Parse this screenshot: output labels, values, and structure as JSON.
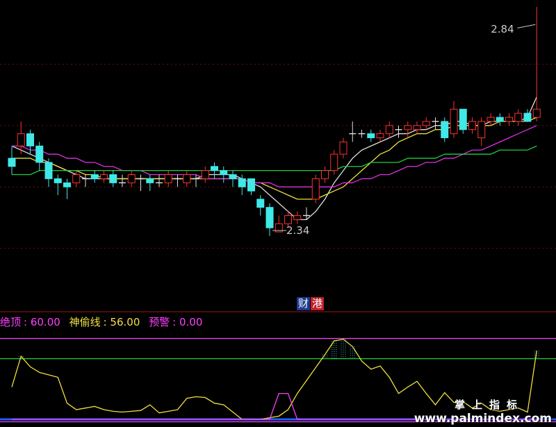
{
  "chart_data": [
    {
      "type": "candlestick",
      "ylim": [
        2.15,
        2.9
      ],
      "annotations": [
        {
          "text": "2.84",
          "value": 2.84
        },
        {
          "text": "2.34",
          "value": 2.34
        }
      ],
      "badges": [
        {
          "text": "财",
          "color": "#1a3a8c"
        },
        {
          "text": "港",
          "color": "#c0202a"
        }
      ],
      "candles": [
        [
          2.52,
          2.5,
          2.55,
          2.48
        ],
        [
          2.55,
          2.58,
          2.61,
          2.53
        ],
        [
          2.58,
          2.55,
          2.59,
          2.53
        ],
        [
          2.55,
          2.51,
          2.56,
          2.49
        ],
        [
          2.51,
          2.47,
          2.52,
          2.45
        ],
        [
          2.47,
          2.46,
          2.48,
          2.43
        ],
        [
          2.46,
          2.45,
          2.47,
          2.42
        ],
        [
          2.46,
          2.48,
          2.49,
          2.45
        ],
        [
          2.47,
          2.47,
          2.48,
          2.45
        ],
        [
          2.48,
          2.47,
          2.49,
          2.46
        ],
        [
          2.47,
          2.48,
          2.49,
          2.46
        ],
        [
          2.48,
          2.46,
          2.49,
          2.45
        ],
        [
          2.46,
          2.46,
          2.48,
          2.45
        ],
        [
          2.46,
          2.48,
          2.49,
          2.45
        ],
        [
          2.47,
          2.47,
          2.48,
          2.44
        ],
        [
          2.47,
          2.46,
          2.48,
          2.44
        ],
        [
          2.46,
          2.46,
          2.48,
          2.45
        ],
        [
          2.46,
          2.48,
          2.49,
          2.45
        ],
        [
          2.47,
          2.47,
          2.48,
          2.45
        ],
        [
          2.46,
          2.48,
          2.49,
          2.45
        ],
        [
          2.47,
          2.47,
          2.48,
          2.45
        ],
        [
          2.47,
          2.49,
          2.5,
          2.46
        ],
        [
          2.5,
          2.49,
          2.51,
          2.47
        ],
        [
          2.49,
          2.48,
          2.5,
          2.46
        ],
        [
          2.48,
          2.47,
          2.49,
          2.45
        ],
        [
          2.47,
          2.45,
          2.48,
          2.43
        ],
        [
          2.47,
          2.44,
          2.47,
          2.43
        ],
        [
          2.42,
          2.4,
          2.43,
          2.38
        ],
        [
          2.4,
          2.35,
          2.41,
          2.33
        ],
        [
          2.34,
          2.36,
          2.38,
          2.34
        ],
        [
          2.36,
          2.38,
          2.39,
          2.35
        ],
        [
          2.37,
          2.38,
          2.39,
          2.36
        ],
        [
          2.38,
          2.38,
          2.4,
          2.37
        ],
        [
          2.42,
          2.47,
          2.48,
          2.41
        ],
        [
          2.47,
          2.49,
          2.5,
          2.46
        ],
        [
          2.49,
          2.53,
          2.54,
          2.48
        ],
        [
          2.53,
          2.56,
          2.57,
          2.52
        ],
        [
          2.58,
          2.58,
          2.61,
          2.56
        ],
        [
          2.58,
          2.58,
          2.59,
          2.57
        ],
        [
          2.58,
          2.57,
          2.59,
          2.56
        ],
        [
          2.57,
          2.58,
          2.59,
          2.56
        ],
        [
          2.58,
          2.6,
          2.61,
          2.57
        ],
        [
          2.59,
          2.59,
          2.6,
          2.57
        ],
        [
          2.59,
          2.6,
          2.61,
          2.57
        ],
        [
          2.59,
          2.6,
          2.61,
          2.58
        ],
        [
          2.6,
          2.61,
          2.62,
          2.59
        ],
        [
          2.61,
          2.61,
          2.62,
          2.59
        ],
        [
          2.61,
          2.57,
          2.62,
          2.56
        ],
        [
          2.58,
          2.64,
          2.66,
          2.57
        ],
        [
          2.64,
          2.59,
          2.64,
          2.58
        ],
        [
          2.59,
          2.61,
          2.62,
          2.58
        ],
        [
          2.57,
          2.61,
          2.62,
          2.55
        ],
        [
          2.61,
          2.62,
          2.63,
          2.6
        ],
        [
          2.62,
          2.61,
          2.63,
          2.6
        ],
        [
          2.61,
          2.62,
          2.63,
          2.6
        ],
        [
          2.61,
          2.63,
          2.64,
          2.6
        ],
        [
          2.63,
          2.61,
          2.64,
          2.61
        ],
        [
          2.62,
          2.64,
          2.89,
          2.61
        ]
      ],
      "series": [
        {
          "color": "#e0e0e0",
          "values": [
            2.55,
            2.54,
            2.53,
            2.52,
            2.51,
            2.5,
            2.49,
            2.48,
            2.47,
            2.47,
            2.47,
            2.47,
            2.47,
            2.47,
            2.47,
            2.47,
            2.47,
            2.47,
            2.47,
            2.47,
            2.47,
            2.48,
            2.48,
            2.48,
            2.48,
            2.47,
            2.46,
            2.45,
            2.43,
            2.41,
            2.39,
            2.37,
            2.37,
            2.39,
            2.42,
            2.46,
            2.49,
            2.52,
            2.54,
            2.55,
            2.56,
            2.57,
            2.58,
            2.58,
            2.59,
            2.59,
            2.6,
            2.6,
            2.61,
            2.61,
            2.6,
            2.6,
            2.61,
            2.61,
            2.61,
            2.61,
            2.62,
            2.67
          ]
        },
        {
          "color": "#f0e040",
          "values": [
            2.52,
            2.52,
            2.52,
            2.51,
            2.51,
            2.5,
            2.49,
            2.49,
            2.48,
            2.48,
            2.47,
            2.47,
            2.47,
            2.47,
            2.47,
            2.47,
            2.47,
            2.47,
            2.47,
            2.47,
            2.47,
            2.47,
            2.47,
            2.47,
            2.47,
            2.47,
            2.46,
            2.46,
            2.45,
            2.44,
            2.43,
            2.42,
            2.42,
            2.42,
            2.43,
            2.44,
            2.45,
            2.47,
            2.49,
            2.51,
            2.53,
            2.54,
            2.56,
            2.57,
            2.58,
            2.58,
            2.59,
            2.59,
            2.6,
            2.6,
            2.6,
            2.6,
            2.6,
            2.61,
            2.61,
            2.61,
            2.61,
            2.62
          ]
        },
        {
          "color": "#e030e0",
          "values": [
            2.55,
            2.55,
            2.54,
            2.54,
            2.53,
            2.53,
            2.52,
            2.52,
            2.51,
            2.51,
            2.5,
            2.5,
            2.49,
            2.49,
            2.49,
            2.48,
            2.48,
            2.48,
            2.48,
            2.48,
            2.48,
            2.47,
            2.47,
            2.47,
            2.47,
            2.47,
            2.46,
            2.46,
            2.46,
            2.45,
            2.45,
            2.45,
            2.45,
            2.45,
            2.45,
            2.45,
            2.46,
            2.46,
            2.47,
            2.47,
            2.48,
            2.48,
            2.49,
            2.5,
            2.5,
            2.51,
            2.51,
            2.52,
            2.52,
            2.53,
            2.54,
            2.54,
            2.55,
            2.56,
            2.57,
            2.58,
            2.59,
            2.6
          ]
        },
        {
          "color": "#20d040",
          "values": [
            2.48,
            2.48,
            2.48,
            2.49,
            2.49,
            2.49,
            2.49,
            2.49,
            2.49,
            2.49,
            2.49,
            2.49,
            2.49,
            2.49,
            2.49,
            2.49,
            2.49,
            2.49,
            2.49,
            2.49,
            2.49,
            2.49,
            2.49,
            2.49,
            2.49,
            2.49,
            2.49,
            2.49,
            2.49,
            2.49,
            2.49,
            2.49,
            2.49,
            2.49,
            2.49,
            2.49,
            2.5,
            2.5,
            2.5,
            2.51,
            2.51,
            2.51,
            2.51,
            2.52,
            2.52,
            2.52,
            2.52,
            2.53,
            2.53,
            2.53,
            2.53,
            2.53,
            2.53,
            2.54,
            2.54,
            2.54,
            2.54,
            2.55
          ]
        }
      ]
    },
    {
      "type": "line",
      "ylim": [
        0,
        115
      ],
      "legend": [
        {
          "label": "绝顶",
          "value": "60.00",
          "color": "#ff40ff"
        },
        {
          "label": "神偷线",
          "value": "56.00",
          "color": "#f0e040"
        },
        {
          "label": "预警",
          "value": "0.00",
          "color": "#ff40ff"
        }
      ],
      "levels": [
        {
          "value": 100,
          "color": "#ff40ff"
        },
        {
          "value": 75,
          "color": "#20d040"
        },
        {
          "value": 0,
          "color": "#2060ff"
        },
        {
          "value": -3,
          "color": "#ff40ff"
        }
      ],
      "series": [
        {
          "name": "神偷线",
          "color": "#f0e040",
          "values": [
            40,
            78,
            65,
            58,
            55,
            52,
            20,
            12,
            14,
            16,
            12,
            10,
            9,
            10,
            11,
            18,
            8,
            10,
            12,
            26,
            28,
            27,
            20,
            18,
            9,
            0,
            0,
            0,
            2,
            4,
            12,
            32,
            48,
            64,
            80,
            97,
            99,
            90,
            72,
            62,
            66,
            52,
            32,
            40,
            47,
            32,
            18,
            33,
            21,
            22,
            14,
            20,
            12,
            10,
            12,
            14,
            9,
            85
          ]
        },
        {
          "name": "预警",
          "color": "#ff40ff",
          "values": [
            0,
            0,
            0,
            0,
            0,
            0,
            0,
            0,
            0,
            0,
            0,
            0,
            0,
            0,
            0,
            0,
            0,
            0,
            0,
            0,
            0,
            0,
            0,
            0,
            0,
            0,
            0,
            0,
            0,
            32,
            32,
            0,
            0,
            0,
            0,
            0,
            0,
            0,
            0,
            0,
            0,
            0,
            0,
            0,
            0,
            0,
            0,
            0,
            0,
            0,
            0,
            0,
            0,
            0,
            0,
            0,
            0,
            0
          ]
        }
      ]
    }
  ],
  "watermark": {
    "name": "掌上指标",
    "url": "www.palmindex.com"
  }
}
